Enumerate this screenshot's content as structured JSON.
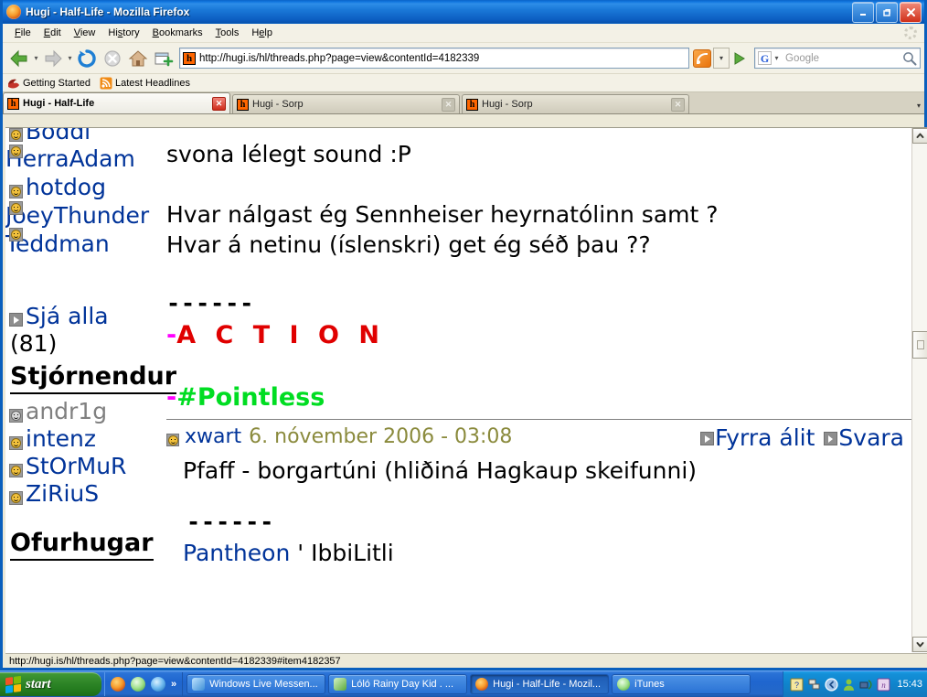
{
  "window": {
    "title": "Hugi - Half-Life - Mozilla Firefox",
    "icon": "firefox-icon",
    "minimize_label": "Minimize",
    "restore_label": "Restore",
    "close_label": "Close"
  },
  "menu": {
    "items": [
      {
        "label": "File",
        "accel": "F"
      },
      {
        "label": "Edit",
        "accel": "E"
      },
      {
        "label": "View",
        "accel": "V"
      },
      {
        "label": "History",
        "accel": "s"
      },
      {
        "label": "Bookmarks",
        "accel": "B"
      },
      {
        "label": "Tools",
        "accel": "T"
      },
      {
        "label": "Help",
        "accel": "H"
      }
    ]
  },
  "toolbar": {
    "back_label": "Back",
    "forward_label": "Forward",
    "reload_label": "Reload",
    "stop_label": "Stop",
    "home_label": "Home",
    "newtab_label": "New Tab",
    "go_label": "Go",
    "url": "http://hugi.is/hl/threads.php?page=view&contentId=4182339",
    "favicon_letter": "h",
    "search": {
      "engine": "Google",
      "engine_letter": "G",
      "placeholder": "Google",
      "value": ""
    }
  },
  "bookmarks": [
    {
      "label": "Getting Started",
      "icon": "firefox-bookmark-icon"
    },
    {
      "label": "Latest Headlines",
      "icon": "rss-feed-icon"
    }
  ],
  "tabs": [
    {
      "label": "Hugi - Half-Life",
      "active": true,
      "favicon_letter": "h"
    },
    {
      "label": "Hugi - Sorp",
      "active": false,
      "favicon_letter": "h"
    },
    {
      "label": "Hugi - Sorp",
      "active": false,
      "favicon_letter": "h"
    }
  ],
  "page": {
    "sidebar": {
      "users_top": [
        {
          "name": "Boddi",
          "status": "online",
          "clipped": true
        },
        {
          "name": "HerraAdam",
          "status": "online"
        },
        {
          "name": "hotdog",
          "status": "online"
        },
        {
          "name": "JoeyThunder",
          "status": "online"
        },
        {
          "name": "Teddman",
          "status": "online"
        }
      ],
      "see_all_label": "Sjá alla",
      "see_all_count": "(81)",
      "section_moderators": "Stjórnendur",
      "moderators": [
        {
          "name": "andr1g",
          "status": "offline"
        },
        {
          "name": "intenz",
          "status": "online"
        },
        {
          "name": "StOrMuR",
          "status": "online"
        },
        {
          "name": "ZiRiuS",
          "status": "online"
        }
      ],
      "section_superfans": "Ofurhugar"
    },
    "thread": {
      "post_top_lines": [
        "svona lélegt sound :P",
        "",
        "Hvar nálgast ég Sennheiser heyrnatólinn samt ?",
        "Hvar á netinu (íslenskri) get ég séð þau ??"
      ],
      "signature_divider": "------",
      "sig_tags": [
        {
          "dash": "-",
          "text": "A C T I O N",
          "color": "#e00000"
        },
        {
          "dash": "-",
          "text": "#Pointless",
          "color": "#00dd22"
        }
      ],
      "post": {
        "author": "xwart",
        "date": "6. nóvember 2006 - 03:08",
        "link_prev": "Fyrra álit",
        "link_reply": "Svara",
        "body": "Pfaff - borgartúni (hliðiná Hagkaup skeifunni)",
        "divider": "------",
        "sig_link": "Pantheon",
        "sig_sep": "'",
        "sig_rest": "IbbiLitli"
      }
    }
  },
  "statusbar": {
    "text": "http://hugi.is/hl/threads.php?page=view&contentId=4182339#item4182357"
  },
  "taskbar": {
    "start_label": "start",
    "quicklaunch": [
      {
        "name": "firefox-quicklaunch-icon"
      },
      {
        "name": "itunes-quicklaunch-icon"
      },
      {
        "name": "ie-quicklaunch-icon"
      }
    ],
    "quicklaunch_more": "»",
    "tasks": [
      {
        "label": "Windows Live Messen...",
        "active": false,
        "icon": "messenger-icon"
      },
      {
        "label": "Lóló Rainy Day Kid .  ...",
        "active": false,
        "icon": "messenger-contact-icon"
      },
      {
        "label": "Hugi - Half-Life - Mozil...",
        "active": true,
        "icon": "firefox-icon"
      },
      {
        "label": "iTunes",
        "active": false,
        "icon": "itunes-icon"
      }
    ],
    "tray": [
      {
        "name": "help-tray-icon"
      },
      {
        "name": "network-tray-icon"
      },
      {
        "name": "show-hidden-icons-icon"
      },
      {
        "name": "user-tray-icon"
      },
      {
        "name": "network-activity-icon"
      },
      {
        "name": "onenote-tray-icon"
      }
    ],
    "clock": "15:43"
  },
  "colors": {
    "link": "#003399",
    "offline_user": "#808080",
    "date": "#8a8a3c",
    "tag_red": "#e00000",
    "tag_green": "#00dd22",
    "dash_magenta": "#ff00ff",
    "titlebar_blue": "#1b7ad9"
  }
}
